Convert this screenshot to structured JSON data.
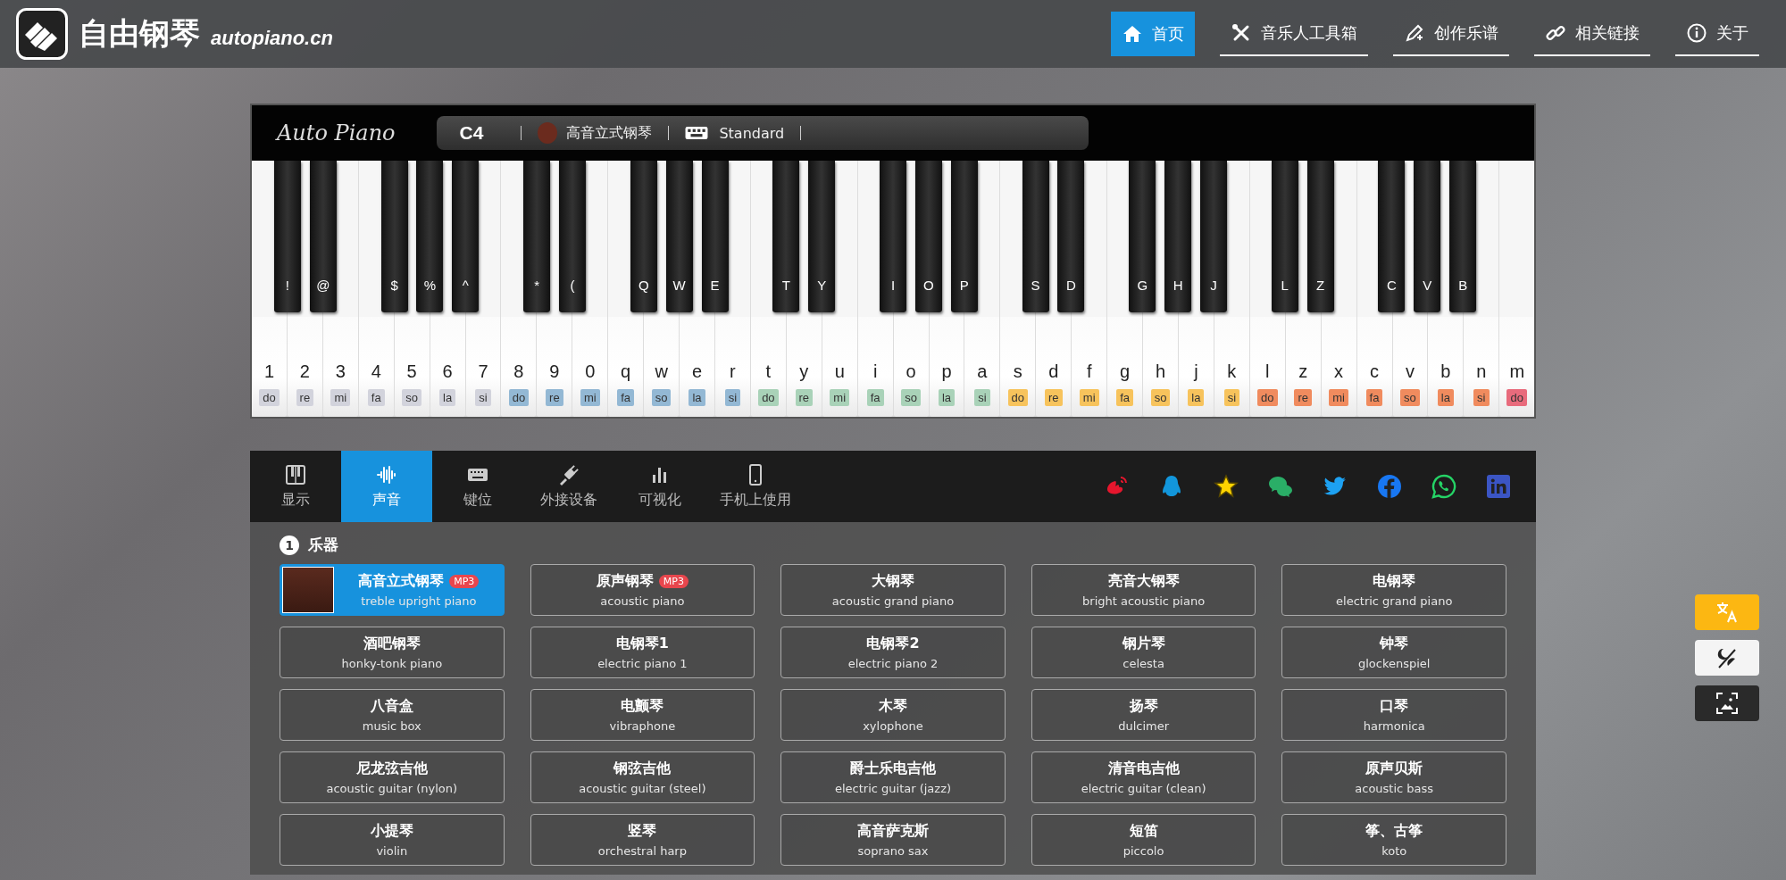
{
  "header": {
    "site_name": "自由钢琴",
    "domain": "autopiano.cn",
    "nav": [
      {
        "label": "首页",
        "selected": true
      },
      {
        "label": "音乐人工具箱",
        "selected": false
      },
      {
        "label": "创作乐谱",
        "selected": false
      },
      {
        "label": "相关链接",
        "selected": false
      },
      {
        "label": "关于",
        "selected": false
      }
    ]
  },
  "piano": {
    "logo": "Auto Piano",
    "note": "C4",
    "instrument": "高音立式钢琴",
    "keymap": "Standard",
    "white_keys": [
      {
        "key": "1",
        "solfege": "do",
        "color": "#d2d3dc",
        "black_key": "!"
      },
      {
        "key": "2",
        "solfege": "re",
        "color": "#d2d3dc",
        "black_key": "@"
      },
      {
        "key": "3",
        "solfege": "mi",
        "color": "#d2d3dc"
      },
      {
        "key": "4",
        "solfege": "fa",
        "color": "#d2d3dc",
        "black_key": "$"
      },
      {
        "key": "5",
        "solfege": "so",
        "color": "#d2d3dc",
        "black_key": "%"
      },
      {
        "key": "6",
        "solfege": "la",
        "color": "#d2d3dc",
        "black_key": "^"
      },
      {
        "key": "7",
        "solfege": "si",
        "color": "#d2d3dc"
      },
      {
        "key": "8",
        "solfege": "do",
        "color": "#93b8d4",
        "black_key": "*"
      },
      {
        "key": "9",
        "solfege": "re",
        "color": "#93b8d4",
        "black_key": "("
      },
      {
        "key": "0",
        "solfege": "mi",
        "color": "#93b8d4"
      },
      {
        "key": "q",
        "solfege": "fa",
        "color": "#93b8d4",
        "black_key": "Q"
      },
      {
        "key": "w",
        "solfege": "so",
        "color": "#93b8d4",
        "black_key": "W"
      },
      {
        "key": "e",
        "solfege": "la",
        "color": "#93b8d4",
        "black_key": "E"
      },
      {
        "key": "r",
        "solfege": "si",
        "color": "#93b8d4"
      },
      {
        "key": "t",
        "solfege": "do",
        "color": "#a9d2b8",
        "black_key": "T"
      },
      {
        "key": "y",
        "solfege": "re",
        "color": "#a9d2b8",
        "black_key": "Y"
      },
      {
        "key": "u",
        "solfege": "mi",
        "color": "#a9d2b8"
      },
      {
        "key": "i",
        "solfege": "fa",
        "color": "#a9d2b8",
        "black_key": "I"
      },
      {
        "key": "o",
        "solfege": "so",
        "color": "#a9d2b8",
        "black_key": "O"
      },
      {
        "key": "p",
        "solfege": "la",
        "color": "#a9d2b8",
        "black_key": "P"
      },
      {
        "key": "a",
        "solfege": "si",
        "color": "#a9d2b8"
      },
      {
        "key": "s",
        "solfege": "do",
        "color": "#f7c35c",
        "black_key": "S"
      },
      {
        "key": "d",
        "solfege": "re",
        "color": "#f7c35c",
        "black_key": "D"
      },
      {
        "key": "f",
        "solfege": "mi",
        "color": "#f7c35c"
      },
      {
        "key": "g",
        "solfege": "fa",
        "color": "#f7c35c",
        "black_key": "G"
      },
      {
        "key": "h",
        "solfege": "so",
        "color": "#f7c35c",
        "black_key": "H"
      },
      {
        "key": "j",
        "solfege": "la",
        "color": "#f7c35c",
        "black_key": "J"
      },
      {
        "key": "k",
        "solfege": "si",
        "color": "#f7c35c"
      },
      {
        "key": "l",
        "solfege": "do",
        "color": "#f08b5e",
        "black_key": "L"
      },
      {
        "key": "z",
        "solfege": "re",
        "color": "#f08b5e",
        "black_key": "Z"
      },
      {
        "key": "x",
        "solfege": "mi",
        "color": "#f08b5e"
      },
      {
        "key": "c",
        "solfege": "fa",
        "color": "#f08b5e",
        "black_key": "C"
      },
      {
        "key": "v",
        "solfege": "so",
        "color": "#f08b5e",
        "black_key": "V"
      },
      {
        "key": "b",
        "solfege": "la",
        "color": "#f08b5e",
        "black_key": "B"
      },
      {
        "key": "n",
        "solfege": "si",
        "color": "#f08b5e"
      },
      {
        "key": "m",
        "solfege": "do",
        "color": "#e86b7c"
      }
    ]
  },
  "panel": {
    "tabs": [
      {
        "label": "显示",
        "selected": false
      },
      {
        "label": "声音",
        "selected": true
      },
      {
        "label": "键位",
        "selected": false
      },
      {
        "label": "外接设备",
        "selected": false
      },
      {
        "label": "可视化",
        "selected": false
      },
      {
        "label": "手机上使用",
        "selected": false
      }
    ],
    "socials": [
      {
        "kind": "swirl",
        "color": "#e6162d"
      },
      {
        "kind": "penguin",
        "color": "#1296db"
      },
      {
        "kind": "star",
        "color": "#ffd400"
      },
      {
        "kind": "bubbles",
        "color": "#2aae67"
      },
      {
        "kind": "bird",
        "color": "#1da1f2"
      },
      {
        "kind": "f-circle",
        "color": "#1877f2"
      },
      {
        "kind": "phone-bubble",
        "color": "#25d366"
      },
      {
        "kind": "in-square",
        "color": "#3b55c4"
      }
    ],
    "section": {
      "number": "1",
      "title": "乐器"
    },
    "instruments": [
      {
        "name": "高音立式钢琴",
        "english": "treble upright piano",
        "badge": "MP3",
        "selected": true
      },
      {
        "name": "原声钢琴",
        "english": "acoustic piano",
        "badge": "MP3",
        "selected": false
      },
      {
        "name": "大钢琴",
        "english": "acoustic grand piano",
        "selected": false
      },
      {
        "name": "亮音大钢琴",
        "english": "bright acoustic piano",
        "selected": false
      },
      {
        "name": "电钢琴",
        "english": "electric grand piano",
        "selected": false
      },
      {
        "name": "酒吧钢琴",
        "english": "honky-tonk piano",
        "selected": false
      },
      {
        "name": "电钢琴1",
        "english": "electric piano 1",
        "selected": false
      },
      {
        "name": "电钢琴2",
        "english": "electric piano 2",
        "selected": false
      },
      {
        "name": "钢片琴",
        "english": "celesta",
        "selected": false
      },
      {
        "name": "钟琴",
        "english": "glockenspiel",
        "selected": false
      },
      {
        "name": "八音盒",
        "english": "music box",
        "selected": false
      },
      {
        "name": "电颤琴",
        "english": "vibraphone",
        "selected": false
      },
      {
        "name": "木琴",
        "english": "xylophone",
        "selected": false
      },
      {
        "name": "扬琴",
        "english": "dulcimer",
        "selected": false
      },
      {
        "name": "口琴",
        "english": "harmonica",
        "selected": false
      },
      {
        "name": "尼龙弦吉他",
        "english": "acoustic guitar (nylon)",
        "selected": false
      },
      {
        "name": "钢弦吉他",
        "english": "acoustic guitar (steel)",
        "selected": false
      },
      {
        "name": "爵士乐电吉他",
        "english": "electric guitar (jazz)",
        "selected": false
      },
      {
        "name": "清音电吉他",
        "english": "electric guitar (clean)",
        "selected": false
      },
      {
        "name": "原声贝斯",
        "english": "acoustic bass",
        "selected": false
      },
      {
        "name": "小提琴",
        "english": "violin",
        "selected": false
      },
      {
        "name": "竖琴",
        "english": "orchestral harp",
        "selected": false
      },
      {
        "name": "高音萨克斯",
        "english": "soprano sax",
        "selected": false
      },
      {
        "name": "短笛",
        "english": "piccolo",
        "selected": false
      },
      {
        "name": "筝、古筝",
        "english": "koto",
        "selected": false
      }
    ]
  },
  "side_buttons": [
    {
      "kind": "translate"
    },
    {
      "kind": "theme"
    },
    {
      "kind": "image"
    }
  ]
}
